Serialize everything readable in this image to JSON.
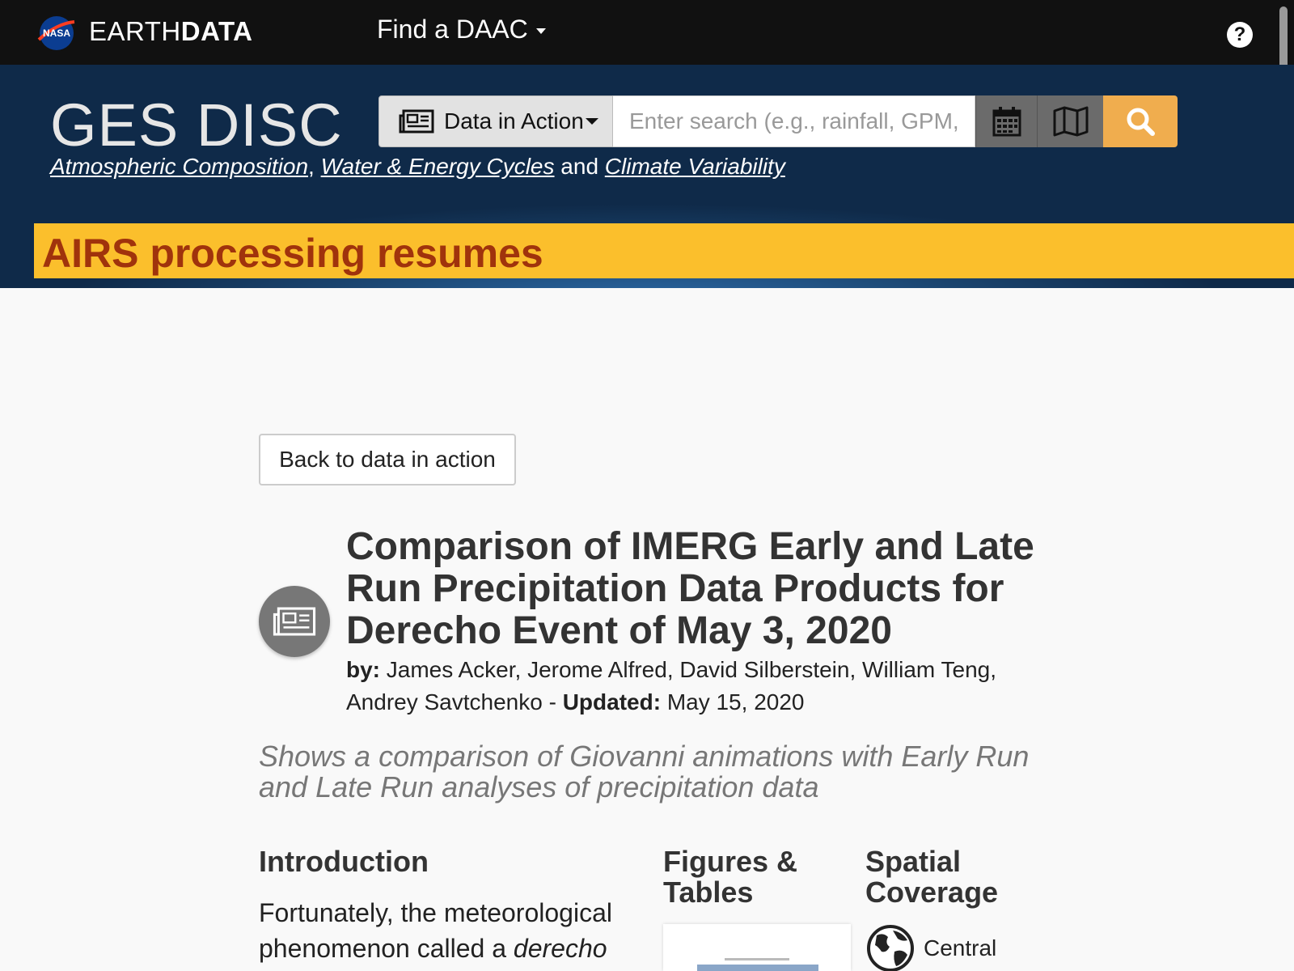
{
  "topbar": {
    "nasa_logo_text": "NASA",
    "brand_light": "EARTH",
    "brand_bold": "DATA",
    "find_daac": "Find a DAAC",
    "help_icon": "?"
  },
  "header": {
    "site_title": "GES DISC",
    "tagline": {
      "link1": "Atmospheric Composition",
      "sep": ",",
      "link2": "Water & Energy Cycles",
      "and": "and",
      "link3": "Climate Variability"
    },
    "search": {
      "category": "Data in Action",
      "placeholder": "Enter search (e.g., rainfall, GPM,",
      "value": ""
    },
    "alert": "AIRS processing resumes"
  },
  "article": {
    "back_label": "Back to data in action",
    "title": "Comparison of IMERG Early and Late Run Precipitation Data Products for Derecho Event of May 3, 2020",
    "by_label": "by:",
    "authors": "James Acker, Jerome Alfred, David Silberstein, William Teng, Andrey Savtchenko",
    "dash": "-",
    "updated_label": "Updated:",
    "updated_date": "May 15, 2020",
    "summary": "Shows a comparison of Giovanni animations with Early Run and Late Run analyses of precipitation data"
  },
  "sections": {
    "intro_heading": "Introduction",
    "intro_text_1": "Fortunately, the meteorological phenomenon called a",
    "intro_text_em": "derecho",
    "figures_heading": "Figures & Tables",
    "spatial_heading": "Spatial Coverage",
    "spatial_value": "Central"
  },
  "colors": {
    "topbar_bg": "#111111",
    "header_bg": "#1b456f",
    "alert_bg": "#fbbf2c",
    "alert_text": "#a0330c",
    "search_button": "#f0ad4e"
  },
  "icons": [
    "nasa-logo",
    "help-icon",
    "newspaper-icon",
    "calendar-icon",
    "map-icon",
    "search-icon",
    "globe-icon"
  ]
}
